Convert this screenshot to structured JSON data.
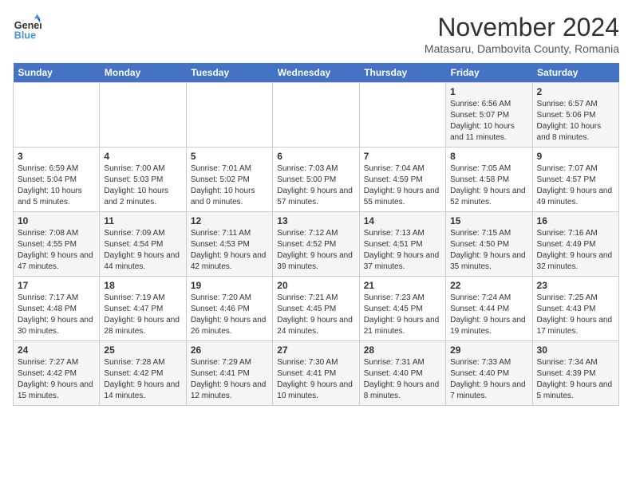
{
  "header": {
    "logo_line1": "General",
    "logo_line2": "Blue",
    "month_title": "November 2024",
    "subtitle": "Matasaru, Dambovita County, Romania"
  },
  "days_of_week": [
    "Sunday",
    "Monday",
    "Tuesday",
    "Wednesday",
    "Thursday",
    "Friday",
    "Saturday"
  ],
  "weeks": [
    [
      {
        "num": "",
        "info": ""
      },
      {
        "num": "",
        "info": ""
      },
      {
        "num": "",
        "info": ""
      },
      {
        "num": "",
        "info": ""
      },
      {
        "num": "",
        "info": ""
      },
      {
        "num": "1",
        "info": "Sunrise: 6:56 AM\nSunset: 5:07 PM\nDaylight: 10 hours and 11 minutes."
      },
      {
        "num": "2",
        "info": "Sunrise: 6:57 AM\nSunset: 5:06 PM\nDaylight: 10 hours and 8 minutes."
      }
    ],
    [
      {
        "num": "3",
        "info": "Sunrise: 6:59 AM\nSunset: 5:04 PM\nDaylight: 10 hours and 5 minutes."
      },
      {
        "num": "4",
        "info": "Sunrise: 7:00 AM\nSunset: 5:03 PM\nDaylight: 10 hours and 2 minutes."
      },
      {
        "num": "5",
        "info": "Sunrise: 7:01 AM\nSunset: 5:02 PM\nDaylight: 10 hours and 0 minutes."
      },
      {
        "num": "6",
        "info": "Sunrise: 7:03 AM\nSunset: 5:00 PM\nDaylight: 9 hours and 57 minutes."
      },
      {
        "num": "7",
        "info": "Sunrise: 7:04 AM\nSunset: 4:59 PM\nDaylight: 9 hours and 55 minutes."
      },
      {
        "num": "8",
        "info": "Sunrise: 7:05 AM\nSunset: 4:58 PM\nDaylight: 9 hours and 52 minutes."
      },
      {
        "num": "9",
        "info": "Sunrise: 7:07 AM\nSunset: 4:57 PM\nDaylight: 9 hours and 49 minutes."
      }
    ],
    [
      {
        "num": "10",
        "info": "Sunrise: 7:08 AM\nSunset: 4:55 PM\nDaylight: 9 hours and 47 minutes."
      },
      {
        "num": "11",
        "info": "Sunrise: 7:09 AM\nSunset: 4:54 PM\nDaylight: 9 hours and 44 minutes."
      },
      {
        "num": "12",
        "info": "Sunrise: 7:11 AM\nSunset: 4:53 PM\nDaylight: 9 hours and 42 minutes."
      },
      {
        "num": "13",
        "info": "Sunrise: 7:12 AM\nSunset: 4:52 PM\nDaylight: 9 hours and 39 minutes."
      },
      {
        "num": "14",
        "info": "Sunrise: 7:13 AM\nSunset: 4:51 PM\nDaylight: 9 hours and 37 minutes."
      },
      {
        "num": "15",
        "info": "Sunrise: 7:15 AM\nSunset: 4:50 PM\nDaylight: 9 hours and 35 minutes."
      },
      {
        "num": "16",
        "info": "Sunrise: 7:16 AM\nSunset: 4:49 PM\nDaylight: 9 hours and 32 minutes."
      }
    ],
    [
      {
        "num": "17",
        "info": "Sunrise: 7:17 AM\nSunset: 4:48 PM\nDaylight: 9 hours and 30 minutes."
      },
      {
        "num": "18",
        "info": "Sunrise: 7:19 AM\nSunset: 4:47 PM\nDaylight: 9 hours and 28 minutes."
      },
      {
        "num": "19",
        "info": "Sunrise: 7:20 AM\nSunset: 4:46 PM\nDaylight: 9 hours and 26 minutes."
      },
      {
        "num": "20",
        "info": "Sunrise: 7:21 AM\nSunset: 4:45 PM\nDaylight: 9 hours and 24 minutes."
      },
      {
        "num": "21",
        "info": "Sunrise: 7:23 AM\nSunset: 4:45 PM\nDaylight: 9 hours and 21 minutes."
      },
      {
        "num": "22",
        "info": "Sunrise: 7:24 AM\nSunset: 4:44 PM\nDaylight: 9 hours and 19 minutes."
      },
      {
        "num": "23",
        "info": "Sunrise: 7:25 AM\nSunset: 4:43 PM\nDaylight: 9 hours and 17 minutes."
      }
    ],
    [
      {
        "num": "24",
        "info": "Sunrise: 7:27 AM\nSunset: 4:42 PM\nDaylight: 9 hours and 15 minutes."
      },
      {
        "num": "25",
        "info": "Sunrise: 7:28 AM\nSunset: 4:42 PM\nDaylight: 9 hours and 14 minutes."
      },
      {
        "num": "26",
        "info": "Sunrise: 7:29 AM\nSunset: 4:41 PM\nDaylight: 9 hours and 12 minutes."
      },
      {
        "num": "27",
        "info": "Sunrise: 7:30 AM\nSunset: 4:41 PM\nDaylight: 9 hours and 10 minutes."
      },
      {
        "num": "28",
        "info": "Sunrise: 7:31 AM\nSunset: 4:40 PM\nDaylight: 9 hours and 8 minutes."
      },
      {
        "num": "29",
        "info": "Sunrise: 7:33 AM\nSunset: 4:40 PM\nDaylight: 9 hours and 7 minutes."
      },
      {
        "num": "30",
        "info": "Sunrise: 7:34 AM\nSunset: 4:39 PM\nDaylight: 9 hours and 5 minutes."
      }
    ]
  ]
}
